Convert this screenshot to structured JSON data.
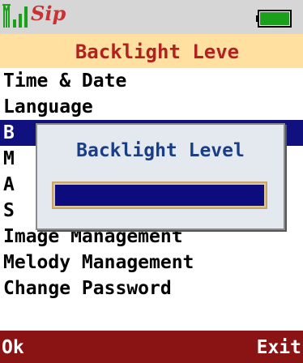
{
  "status_bar": {
    "signal_icon": "signal-strength-icon",
    "brand": "Sip",
    "battery_icon": "battery-icon",
    "battery_level": 1.0,
    "battery_color": "#1aa01a"
  },
  "title": "Backlight Leve",
  "menu": {
    "items": [
      {
        "label": "Time & Date",
        "selected": false
      },
      {
        "label": "Language",
        "selected": false
      },
      {
        "label": "B",
        "selected": true
      },
      {
        "label": "M",
        "selected": false
      },
      {
        "label": "A",
        "selected": false
      },
      {
        "label": "S",
        "selected": false
      },
      {
        "label": "Image Management",
        "selected": false
      },
      {
        "label": "Melody Management",
        "selected": false
      },
      {
        "label": "Change Password",
        "selected": false
      }
    ]
  },
  "dialog": {
    "title": "Backlight Level",
    "level_fraction": 1.0,
    "fill_color": "#0c0c7e"
  },
  "softkeys": {
    "left": "Ok",
    "right": "Exit"
  },
  "colors": {
    "title_bg": "#ffe0a0",
    "title_text": "#b22020",
    "selection": "#10107e",
    "softkey_bg": "#8a1414",
    "dialog_title": "#1a3e86"
  }
}
